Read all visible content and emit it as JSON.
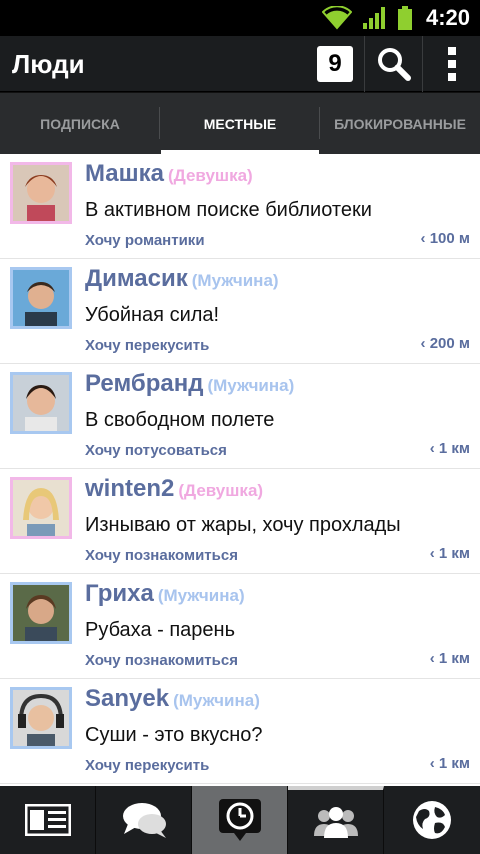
{
  "status_bar": {
    "time": "4:20",
    "icons": [
      "wifi-icon",
      "signal-icon",
      "battery-icon"
    ]
  },
  "action_bar": {
    "title": "Люди",
    "notification_count": "9",
    "icons": [
      "search-icon",
      "overflow-menu-icon"
    ]
  },
  "tabs": [
    {
      "label": "ПОДПИСКА",
      "active": false
    },
    {
      "label": "МЕСТНЫЕ",
      "active": true
    },
    {
      "label": "БЛОКИРОВАННЫЕ",
      "active": false
    }
  ],
  "people": [
    {
      "name": "Машка",
      "gender": "(Девушка)",
      "gender_color": "#f0a8e0",
      "frame_color": "#f2b8e8",
      "status": "В активном поиске библиотеки",
      "wish": "Хочу романтики",
      "distance": "‹ 100 м"
    },
    {
      "name": "Димасик",
      "gender": "(Мужчина)",
      "gender_color": "#a8c4ee",
      "frame_color": "#a8c8f0",
      "status": "Убойная сила!",
      "wish": "Хочу перекусить",
      "distance": "‹ 200 м"
    },
    {
      "name": "Рембранд",
      "gender": "(Мужчина)",
      "gender_color": "#a8c4ee",
      "frame_color": "#a8c8f0",
      "status": "В свободном полете",
      "wish": "Хочу потусоваться",
      "distance": "‹ 1 км"
    },
    {
      "name": "winten2",
      "gender": "(Девушка)",
      "gender_color": "#f0a8e0",
      "frame_color": "#f2b8e8",
      "status": "Изнываю от жары, хочу прохлады",
      "wish": "Хочу познакомиться",
      "distance": "‹ 1 км"
    },
    {
      "name": "Гриха",
      "gender": "(Мужчина)",
      "gender_color": "#a8c4ee",
      "frame_color": "#a8c8f0",
      "status": "Рубаха - парень",
      "wish": "Хочу познакомиться",
      "distance": "‹ 1 км"
    },
    {
      "name": "Sanyek",
      "gender": "(Мужчина)",
      "gender_color": "#a8c4ee",
      "frame_color": "#a8c8f0",
      "status": "Суши - это вкусно?",
      "wish": "Хочу перекусить",
      "distance": "‹ 1 км"
    }
  ],
  "bottom_nav": [
    {
      "icon": "news-feed-icon",
      "active": false
    },
    {
      "icon": "chat-bubbles-icon",
      "active": false
    },
    {
      "icon": "clock-bubble-icon",
      "active": true
    },
    {
      "icon": "people-icon",
      "active": true
    },
    {
      "icon": "globe-icon",
      "active": false
    }
  ],
  "colors": {
    "accent": "#5a6d9e",
    "female": "#f0a8e0",
    "male": "#a8c4ee",
    "bar": "#1b1d1f"
  }
}
